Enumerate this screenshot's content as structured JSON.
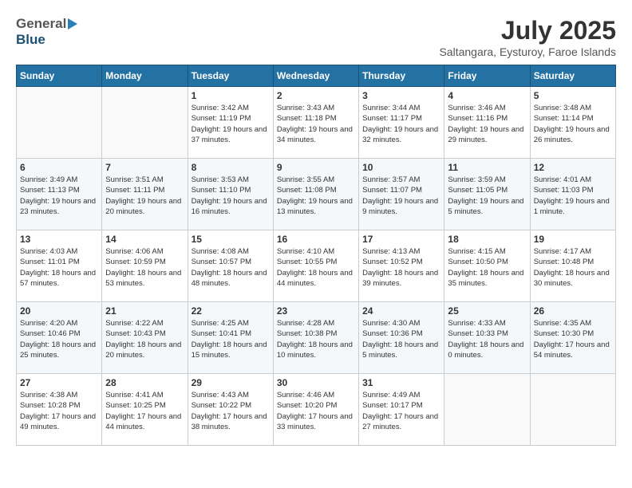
{
  "header": {
    "logo_general": "General",
    "logo_blue": "Blue",
    "title": "July 2025",
    "location": "Saltangara, Eysturoy, Faroe Islands"
  },
  "weekdays": [
    "Sunday",
    "Monday",
    "Tuesday",
    "Wednesday",
    "Thursday",
    "Friday",
    "Saturday"
  ],
  "weeks": [
    [
      {
        "day": "",
        "detail": ""
      },
      {
        "day": "",
        "detail": ""
      },
      {
        "day": "1",
        "detail": "Sunrise: 3:42 AM\nSunset: 11:19 PM\nDaylight: 19 hours\nand 37 minutes."
      },
      {
        "day": "2",
        "detail": "Sunrise: 3:43 AM\nSunset: 11:18 PM\nDaylight: 19 hours\nand 34 minutes."
      },
      {
        "day": "3",
        "detail": "Sunrise: 3:44 AM\nSunset: 11:17 PM\nDaylight: 19 hours\nand 32 minutes."
      },
      {
        "day": "4",
        "detail": "Sunrise: 3:46 AM\nSunset: 11:16 PM\nDaylight: 19 hours\nand 29 minutes."
      },
      {
        "day": "5",
        "detail": "Sunrise: 3:48 AM\nSunset: 11:14 PM\nDaylight: 19 hours\nand 26 minutes."
      }
    ],
    [
      {
        "day": "6",
        "detail": "Sunrise: 3:49 AM\nSunset: 11:13 PM\nDaylight: 19 hours\nand 23 minutes."
      },
      {
        "day": "7",
        "detail": "Sunrise: 3:51 AM\nSunset: 11:11 PM\nDaylight: 19 hours\nand 20 minutes."
      },
      {
        "day": "8",
        "detail": "Sunrise: 3:53 AM\nSunset: 11:10 PM\nDaylight: 19 hours\nand 16 minutes."
      },
      {
        "day": "9",
        "detail": "Sunrise: 3:55 AM\nSunset: 11:08 PM\nDaylight: 19 hours\nand 13 minutes."
      },
      {
        "day": "10",
        "detail": "Sunrise: 3:57 AM\nSunset: 11:07 PM\nDaylight: 19 hours\nand 9 minutes."
      },
      {
        "day": "11",
        "detail": "Sunrise: 3:59 AM\nSunset: 11:05 PM\nDaylight: 19 hours\nand 5 minutes."
      },
      {
        "day": "12",
        "detail": "Sunrise: 4:01 AM\nSunset: 11:03 PM\nDaylight: 19 hours\nand 1 minute."
      }
    ],
    [
      {
        "day": "13",
        "detail": "Sunrise: 4:03 AM\nSunset: 11:01 PM\nDaylight: 18 hours\nand 57 minutes."
      },
      {
        "day": "14",
        "detail": "Sunrise: 4:06 AM\nSunset: 10:59 PM\nDaylight: 18 hours\nand 53 minutes."
      },
      {
        "day": "15",
        "detail": "Sunrise: 4:08 AM\nSunset: 10:57 PM\nDaylight: 18 hours\nand 48 minutes."
      },
      {
        "day": "16",
        "detail": "Sunrise: 4:10 AM\nSunset: 10:55 PM\nDaylight: 18 hours\nand 44 minutes."
      },
      {
        "day": "17",
        "detail": "Sunrise: 4:13 AM\nSunset: 10:52 PM\nDaylight: 18 hours\nand 39 minutes."
      },
      {
        "day": "18",
        "detail": "Sunrise: 4:15 AM\nSunset: 10:50 PM\nDaylight: 18 hours\nand 35 minutes."
      },
      {
        "day": "19",
        "detail": "Sunrise: 4:17 AM\nSunset: 10:48 PM\nDaylight: 18 hours\nand 30 minutes."
      }
    ],
    [
      {
        "day": "20",
        "detail": "Sunrise: 4:20 AM\nSunset: 10:46 PM\nDaylight: 18 hours\nand 25 minutes."
      },
      {
        "day": "21",
        "detail": "Sunrise: 4:22 AM\nSunset: 10:43 PM\nDaylight: 18 hours\nand 20 minutes."
      },
      {
        "day": "22",
        "detail": "Sunrise: 4:25 AM\nSunset: 10:41 PM\nDaylight: 18 hours\nand 15 minutes."
      },
      {
        "day": "23",
        "detail": "Sunrise: 4:28 AM\nSunset: 10:38 PM\nDaylight: 18 hours\nand 10 minutes."
      },
      {
        "day": "24",
        "detail": "Sunrise: 4:30 AM\nSunset: 10:36 PM\nDaylight: 18 hours\nand 5 minutes."
      },
      {
        "day": "25",
        "detail": "Sunrise: 4:33 AM\nSunset: 10:33 PM\nDaylight: 18 hours\nand 0 minutes."
      },
      {
        "day": "26",
        "detail": "Sunrise: 4:35 AM\nSunset: 10:30 PM\nDaylight: 17 hours\nand 54 minutes."
      }
    ],
    [
      {
        "day": "27",
        "detail": "Sunrise: 4:38 AM\nSunset: 10:28 PM\nDaylight: 17 hours\nand 49 minutes."
      },
      {
        "day": "28",
        "detail": "Sunrise: 4:41 AM\nSunset: 10:25 PM\nDaylight: 17 hours\nand 44 minutes."
      },
      {
        "day": "29",
        "detail": "Sunrise: 4:43 AM\nSunset: 10:22 PM\nDaylight: 17 hours\nand 38 minutes."
      },
      {
        "day": "30",
        "detail": "Sunrise: 4:46 AM\nSunset: 10:20 PM\nDaylight: 17 hours\nand 33 minutes."
      },
      {
        "day": "31",
        "detail": "Sunrise: 4:49 AM\nSunset: 10:17 PM\nDaylight: 17 hours\nand 27 minutes."
      },
      {
        "day": "",
        "detail": ""
      },
      {
        "day": "",
        "detail": ""
      }
    ]
  ]
}
